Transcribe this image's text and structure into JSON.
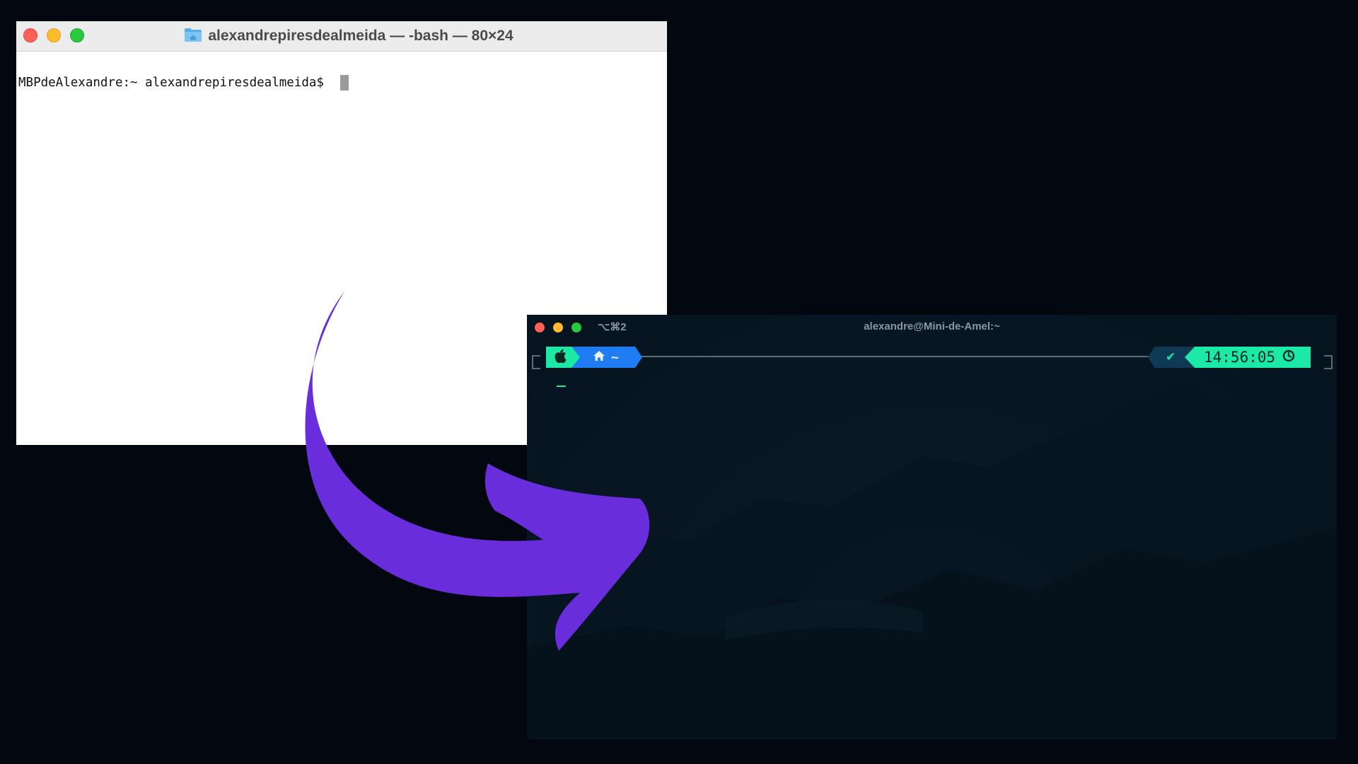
{
  "light_terminal": {
    "title": "alexandrepiresdealmeida — -bash — 80×24",
    "prompt": "MBPdeAlexandre:~ alexandrepiresdealmeida$ "
  },
  "dark_terminal": {
    "shortcut": "⌥⌘2",
    "title": "alexandre@Mini-de-Amel:~",
    "prompt": {
      "dir": "~",
      "status": "✔",
      "time": "14:56:05"
    }
  },
  "colors": {
    "background": "#03070f",
    "accent_purple": "#6a2ddc",
    "prompt_green": "#1de9a6",
    "prompt_blue": "#1f7cf2"
  },
  "icons": {
    "light_title_icon": "folder-home-icon",
    "os_segment": "apple-icon",
    "dir_segment": "home-icon",
    "time_segment": "clock-icon"
  }
}
